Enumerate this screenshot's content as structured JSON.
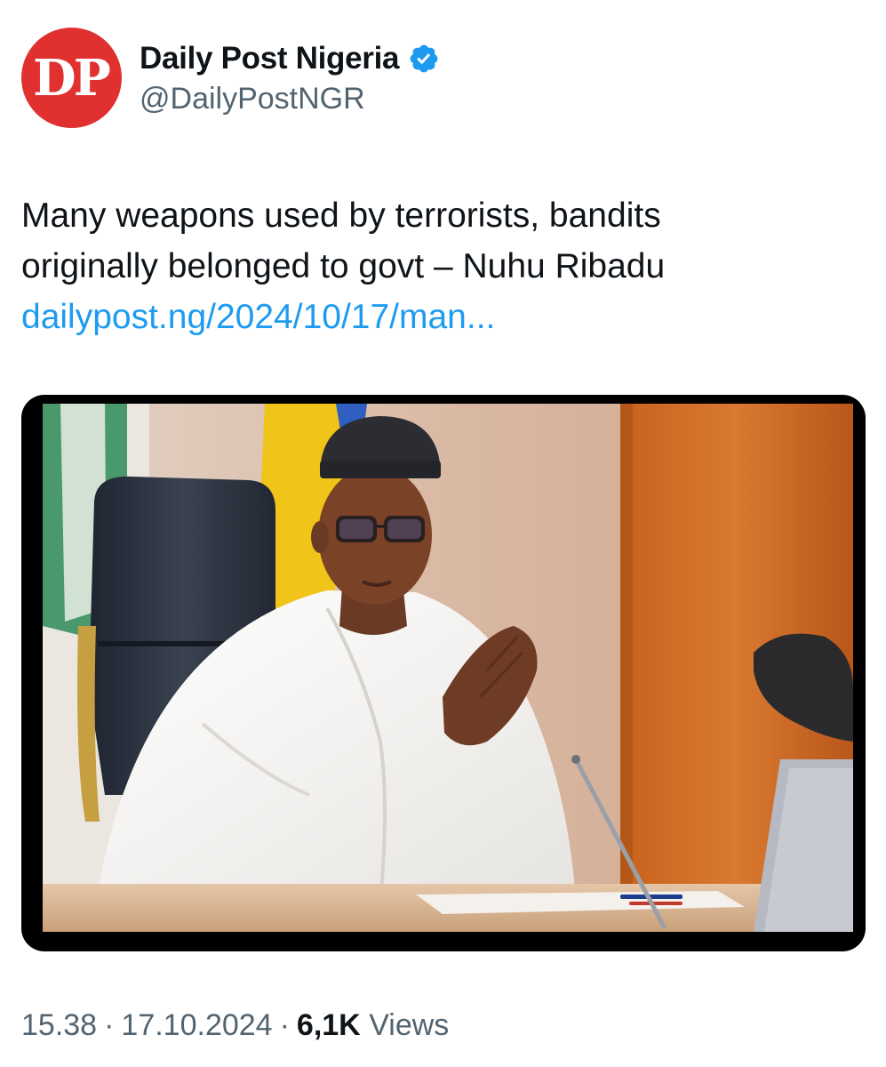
{
  "author": {
    "avatar_text": "DP",
    "display_name": "Daily Post Nigeria",
    "handle": "@DailyPostNGR",
    "verified": true,
    "brand_color": "#e0302f",
    "verified_color": "#1d9bf0"
  },
  "post": {
    "text_line1": "Many weapons used by terrorists, bandits",
    "text_line2": "originally belonged to govt – Nuhu Ribadu",
    "link_text": "dailypost.ng/2024/10/17/man...",
    "link_color": "#1d9bf0",
    "media": {
      "type": "photo"
    }
  },
  "meta": {
    "time": "15.38",
    "separator": "·",
    "date": "17.10.2024",
    "views_count": "6,1K",
    "views_label": "Views"
  }
}
